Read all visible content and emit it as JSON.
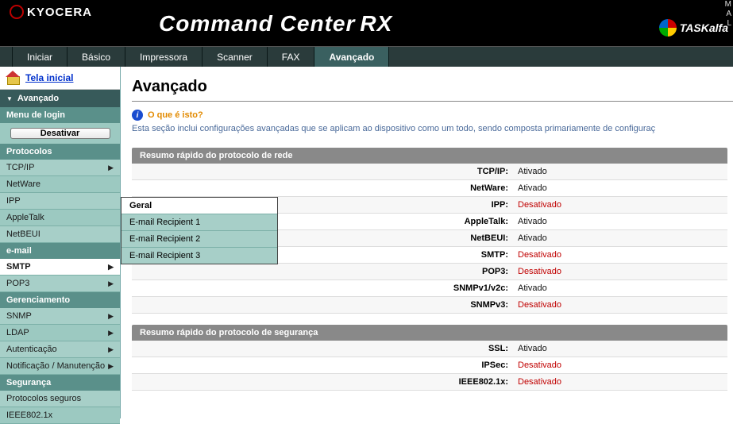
{
  "header": {
    "brand": "KYOCERA",
    "product": "Command Center",
    "product_suffix": "RX",
    "model": "TASKalfa",
    "corner_links": [
      "M",
      "A",
      "L"
    ]
  },
  "topnav": {
    "tabs": [
      {
        "label": "Iniciar"
      },
      {
        "label": "Básico"
      },
      {
        "label": "Impressora"
      },
      {
        "label": "Scanner"
      },
      {
        "label": "FAX"
      },
      {
        "label": "Avançado",
        "active": true
      }
    ]
  },
  "sidebar": {
    "home": "Tela inicial",
    "section": "Avançado",
    "login_header": "Menu de login",
    "deactivate": "Desativar",
    "groups": {
      "protocols_header": "Protocolos",
      "protocols": [
        {
          "label": "TCP/IP",
          "arrow": true
        },
        {
          "label": "NetWare",
          "arrow": false
        },
        {
          "label": "IPP",
          "arrow": false
        },
        {
          "label": "AppleTalk",
          "arrow": false
        },
        {
          "label": "NetBEUI",
          "arrow": false
        }
      ],
      "email_header": "e-mail",
      "email": [
        {
          "label": "SMTP",
          "arrow": true,
          "selected": true
        },
        {
          "label": "POP3",
          "arrow": true
        }
      ],
      "mgmt_header": "Gerenciamento",
      "mgmt": [
        {
          "label": "SNMP",
          "arrow": true
        },
        {
          "label": "LDAP",
          "arrow": true
        },
        {
          "label": "Autenticação",
          "arrow": true
        },
        {
          "label": "Notificação / Manutenção",
          "arrow": true
        }
      ],
      "security_header": "Segurança",
      "security": [
        {
          "label": "Protocolos seguros",
          "arrow": false
        },
        {
          "label": "IEEE802.1x",
          "arrow": false
        }
      ]
    },
    "flyout": [
      "Geral",
      "E-mail Recipient 1",
      "E-mail Recipient 2",
      "E-mail Recipient 3"
    ]
  },
  "content": {
    "title": "Avançado",
    "info_link": "O que é isto?",
    "description": "Esta seção inclui configurações avançadas que se aplicam ao dispositivo como um todo, sendo composta primariamente de configuraç",
    "panels": [
      {
        "title": "Resumo rápido do protocolo de rede",
        "rows": [
          {
            "label": "TCP/IP:",
            "value": "Ativado",
            "state": "on"
          },
          {
            "label": "NetWare:",
            "value": "Ativado",
            "state": "on"
          },
          {
            "label": "IPP:",
            "value": "Desativado",
            "state": "off"
          },
          {
            "label": "AppleTalk:",
            "value": "Ativado",
            "state": "on"
          },
          {
            "label": "NetBEUI:",
            "value": "Ativado",
            "state": "on"
          },
          {
            "label": "SMTP:",
            "value": "Desativado",
            "state": "off"
          },
          {
            "label": "POP3:",
            "value": "Desativado",
            "state": "off"
          },
          {
            "label": "SNMPv1/v2c:",
            "value": "Ativado",
            "state": "on"
          },
          {
            "label": "SNMPv3:",
            "value": "Desativado",
            "state": "off"
          }
        ]
      },
      {
        "title": "Resumo rápido do protocolo de segurança",
        "rows": [
          {
            "label": "SSL:",
            "value": "Ativado",
            "state": "on"
          },
          {
            "label": "IPSec:",
            "value": "Desativado",
            "state": "off"
          },
          {
            "label": "IEEE802.1x:",
            "value": "Desativado",
            "state": "off"
          }
        ]
      }
    ]
  }
}
